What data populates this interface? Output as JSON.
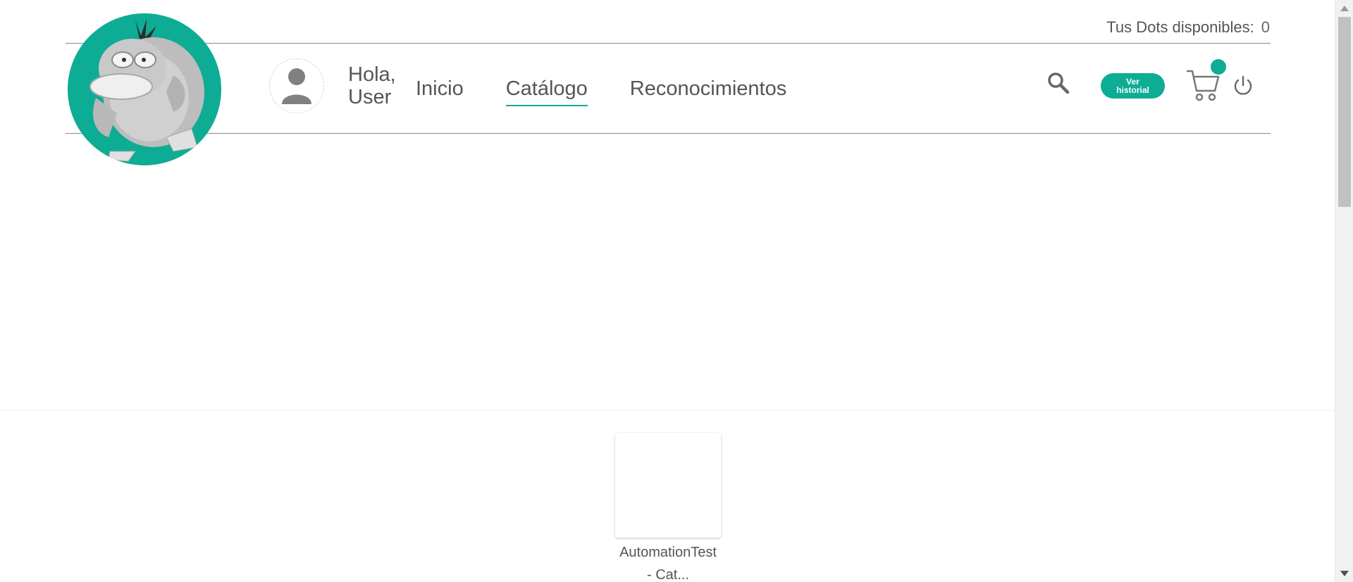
{
  "header": {
    "dots_label": "Tus Dots disponibles:",
    "dots_value": "0",
    "greeting_line1": "Hola,",
    "greeting_line2": "User",
    "nav": [
      {
        "label": "Inicio",
        "active": false
      },
      {
        "label": "Catálogo",
        "active": true
      },
      {
        "label": "Reconocimientos",
        "active": false
      }
    ],
    "historial_line1": "Ver",
    "historial_line2": "historial"
  },
  "product": {
    "name_line1": "AutomationTest",
    "name_line2": "- Cat..."
  },
  "colors": {
    "accent": "#0dac95",
    "text": "#555555",
    "divider": "#888888"
  },
  "icons": {
    "logo": "duck-mascot-logo",
    "avatar": "user-avatar-icon",
    "search": "search-icon",
    "cart": "cart-icon",
    "power": "power-icon"
  }
}
